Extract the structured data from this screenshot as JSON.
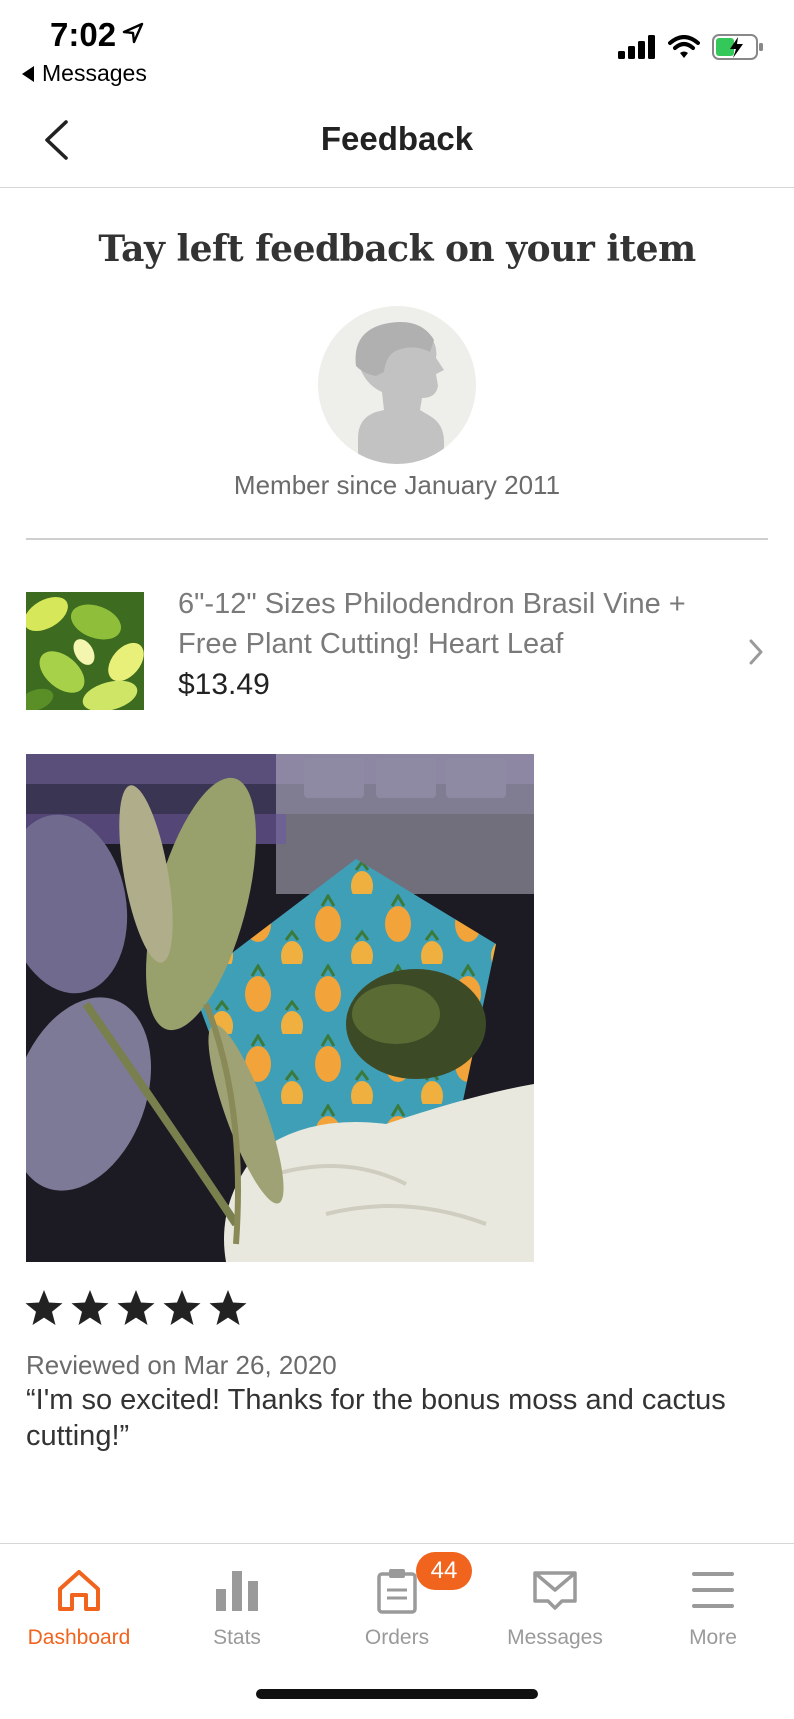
{
  "status_bar": {
    "time": "7:02",
    "back_app": "Messages"
  },
  "nav": {
    "title": "Feedback"
  },
  "feedback": {
    "heading": "Tay left feedback on your item",
    "member_since": "Member since January 2011"
  },
  "listing": {
    "title": "6\"-12\" Sizes Philodendron Brasil Vine + Free Plant Cutting! Heart Leaf",
    "price": "$13.49"
  },
  "review": {
    "rating": 5,
    "rating_max": 5,
    "date": "Reviewed on Mar 26, 2020",
    "text": "“I'm so excited! Thanks for the bonus moss and cactus cutting!”"
  },
  "tabs": [
    {
      "label": "Dashboard",
      "icon": "home-icon",
      "active": true
    },
    {
      "label": "Stats",
      "icon": "bar-chart-icon",
      "active": false
    },
    {
      "label": "Orders",
      "icon": "clipboard-icon",
      "active": false,
      "badge": "44"
    },
    {
      "label": "Messages",
      "icon": "envelope-icon",
      "active": false
    },
    {
      "label": "More",
      "icon": "menu-icon",
      "active": false
    }
  ],
  "colors": {
    "accent": "#f1641e",
    "text": "#222222",
    "muted": "#6b6b6b"
  }
}
